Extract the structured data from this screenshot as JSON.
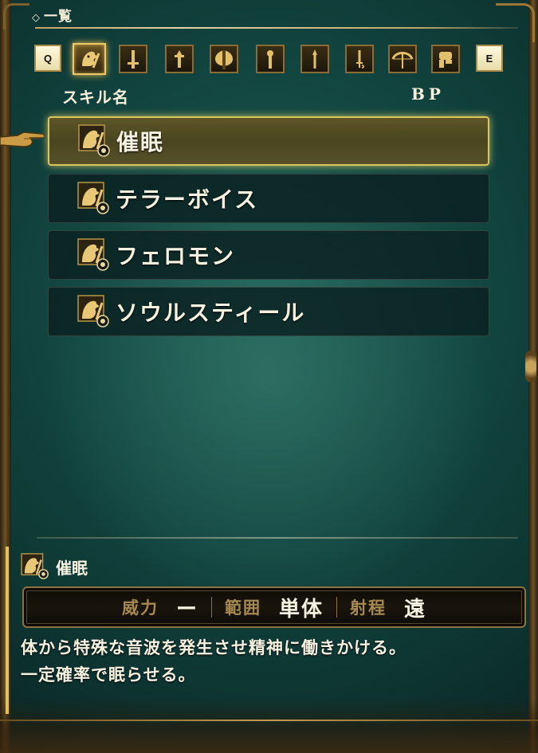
{
  "header": {
    "title": "一覧"
  },
  "tabs": {
    "prev_key": "Q",
    "next_key": "E",
    "items": [
      {
        "icon": "beast-head-icon",
        "active": true
      },
      {
        "icon": "sword-icon",
        "active": false
      },
      {
        "icon": "spear-icon",
        "active": false
      },
      {
        "icon": "axe-icon",
        "active": false
      },
      {
        "icon": "staff-icon",
        "active": false
      },
      {
        "icon": "lance-icon",
        "active": false
      },
      {
        "icon": "dagger-icon",
        "active": false
      },
      {
        "icon": "bow-icon",
        "active": false
      },
      {
        "icon": "fist-icon",
        "active": false
      }
    ]
  },
  "columns": {
    "name": "スキル名",
    "bp": "BP"
  },
  "skills": [
    {
      "name": "催眠",
      "selected": true
    },
    {
      "name": "テラーボイス",
      "selected": false
    },
    {
      "name": "フェロモン",
      "selected": false
    },
    {
      "name": "ソウルスティール",
      "selected": false
    }
  ],
  "detail": {
    "name": "催眠",
    "power_label": "威力",
    "power_value": "ー",
    "range_label": "範囲",
    "range_value": "単体",
    "distance_label": "射程",
    "distance_value": "遠",
    "description_line1": "体から特殊な音波を発生させ精神に働きかける。",
    "description_line2": "一定確率で眠らせる。"
  },
  "colors": {
    "accent": "#e3c34f",
    "selected_row": "#4a4520",
    "frame": "#8d7240"
  }
}
